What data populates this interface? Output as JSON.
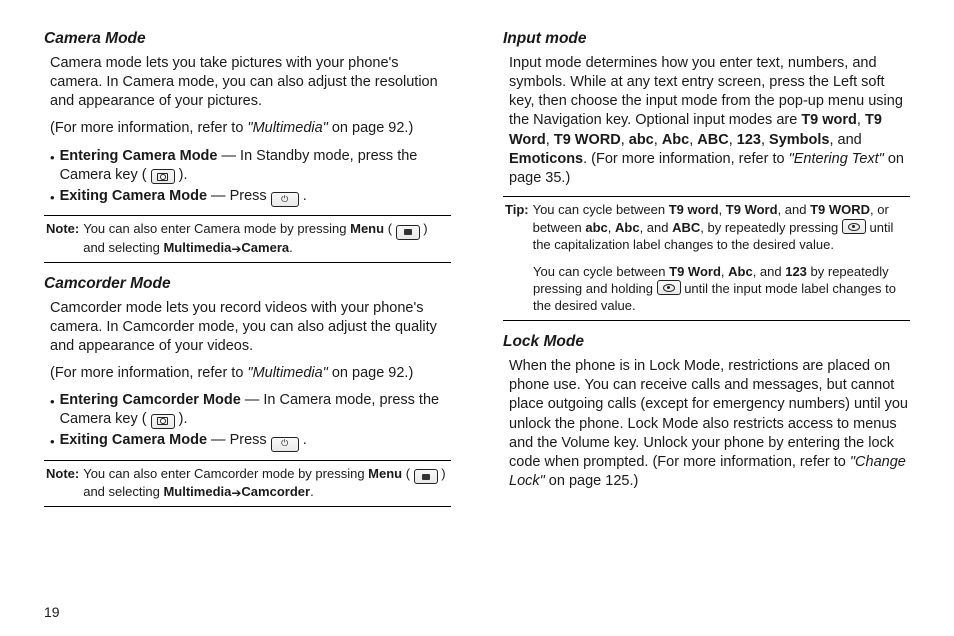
{
  "page_number": "19",
  "left": {
    "camera": {
      "title": "Camera Mode",
      "p1": "Camera mode lets you take pictures with your phone's camera. In Camera mode, you can also adjust the resolution and appearance of your pictures.",
      "ref_prefix": "(For more information, refer to ",
      "ref_italic": "\"Multimedia\"",
      "ref_suffix": "  on page 92.)",
      "b1_label": "Entering Camera Mode",
      "b1_text": " — In Standby mode, press the Camera key ( ",
      "b1_text_end": " ).",
      "b2_label": "Exiting Camera Mode",
      "b2_text": " — Press ",
      "b2_text_end": " .",
      "note_label": "Note:",
      "note_t1": "You can also enter Camera mode by pressing ",
      "note_menu": "Menu",
      "note_t2": " ( ",
      "note_t3": " ) and selecting ",
      "note_path1": "Multimedia",
      "note_arrow": " ➔ ",
      "note_path2": "Camera",
      "note_end": "."
    },
    "camcorder": {
      "title": "Camcorder Mode",
      "p1": "Camcorder mode lets you record videos with your phone's camera. In Camcorder mode, you can also adjust the quality and appearance of your videos.",
      "ref_prefix": "(For more information, refer to ",
      "ref_italic": "\"Multimedia\"",
      "ref_suffix": "  on page 92.)",
      "b1_label": "Entering Camcorder Mode",
      "b1_text": " — In Camera mode, press the Camera key ( ",
      "b1_text_end": " ).",
      "b2_label": "Exiting Camera Mode",
      "b2_text": " — Press ",
      "b2_text_end": " .",
      "note_label": "Note:",
      "note_t1": "You can also enter Camcorder mode by pressing ",
      "note_menu": "Menu",
      "note_t2": " ( ",
      "note_t3": " ) and selecting ",
      "note_path1": "Multimedia",
      "note_arrow": " ➔ ",
      "note_path2": "Camcorder",
      "note_end": "."
    }
  },
  "right": {
    "input": {
      "title": "Input mode",
      "p1a": "Input mode determines how you enter text, numbers, and symbols. While at any text entry screen, press the Left soft key, then choose the input mode from the pop-up menu using the Navigation key. Optional input modes are ",
      "m1": "T9 word",
      "c": ", ",
      "m2": "T9 Word",
      "m3": "T9 WORD",
      "m4": "abc",
      "m5": "Abc",
      "m6": "ABC",
      "m7": "123",
      "m8": "Symbols",
      "and": ", and ",
      "m9": "Emoticons",
      "p1b": ". (For more information, refer to ",
      "ref_italic": "\"Entering Text\"",
      "p1c": "  on page 35.)",
      "tip_label": "Tip:",
      "tip1_a": "You can cycle between ",
      "tip1_m1": "T9 word",
      "tip1_m2": "T9 Word",
      "tip1_m3": "T9 WORD",
      "tip1_mid": ", or between ",
      "tip1_m4": "abc",
      "tip1_m5": "Abc",
      "tip1_m6": "ABC",
      "tip1_b": ", by repeatedly pressing ",
      "tip1_c": " until the capitalization label changes to the desired value.",
      "tip2_a": "You can cycle between ",
      "tip2_m1": "T9 Word",
      "tip2_m2": "Abc",
      "tip2_m3": "123",
      "tip2_b": " by repeatedly pressing and holding ",
      "tip2_c": " until the input mode label changes to the desired value."
    },
    "lock": {
      "title": "Lock Mode",
      "p1a": "When the phone is in Lock Mode, restrictions are placed on phone use. You can receive calls and messages, but cannot place outgoing calls (except for emergency numbers) until you unlock the phone. Lock Mode also restricts access to menus and the Volume key. Unlock your phone by entering the lock code when prompted. (For more information, refer to ",
      "ref_italic": "\"Change Lock\"",
      "p1b": "  on page 125.)"
    }
  }
}
